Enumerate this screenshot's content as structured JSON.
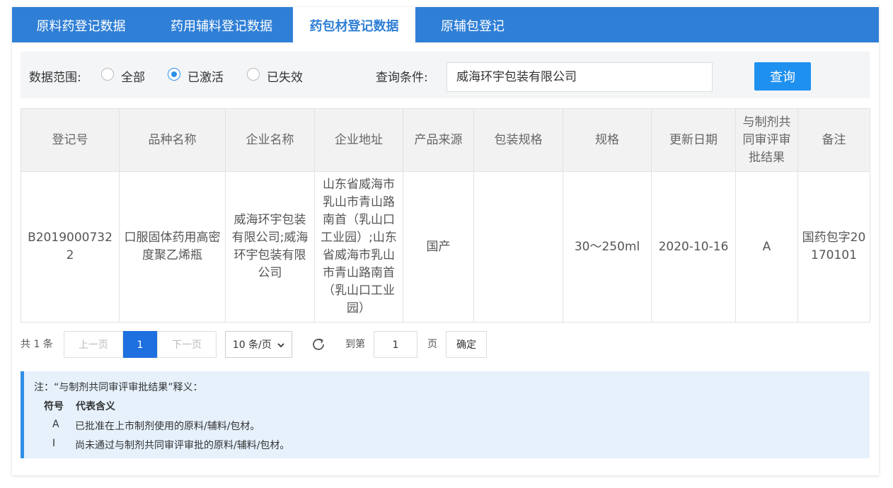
{
  "tabs": [
    "原料药登记数据",
    "药用辅料登记数据",
    "药包材登记数据",
    "原辅包登记"
  ],
  "filter": {
    "range_label": "数据范围:",
    "options": [
      "全部",
      "已激活",
      "已失效"
    ],
    "selected": "已激活",
    "query_label": "查询条件:",
    "query_value": "威海环宇包装有限公司",
    "search_button": "查询"
  },
  "table": {
    "headers": [
      "登记号",
      "品种名称",
      "企业名称",
      "企业地址",
      "产品来源",
      "包装规格",
      "规格",
      "更新日期",
      "与制剂共同审评审批结果",
      "备注"
    ],
    "rows": [
      [
        "B20190007322",
        "口服固体药用高密度聚乙烯瓶",
        "威海环宇包装有限公司;威海环宇包装有限公司",
        "山东省威海市乳山市青山路南首（乳山口工业园）;山东省威海市乳山市青山路南首（乳山口工业园）",
        "国产",
        "",
        "30～250ml",
        "2020-10-16",
        "A",
        "国药包字20170101"
      ]
    ]
  },
  "pager": {
    "total_text": "共 1 条",
    "prev": "上一页",
    "current": "1",
    "next": "下一页",
    "page_size": "10 条/页",
    "goto_label": "到第",
    "goto_value": "1",
    "page_suffix": "页",
    "confirm": "确定"
  },
  "note": {
    "title": "注：“与制剂共同审评审批结果”释义：",
    "col_symbol": "符号",
    "col_meaning": "代表含义",
    "items": [
      {
        "symbol": "A",
        "meaning": "已批准在上市制剂使用的原料/辅料/包材。"
      },
      {
        "symbol": "I",
        "meaning": "尚未通过与制剂共同审评审批的原料/辅料/包材。"
      }
    ]
  }
}
